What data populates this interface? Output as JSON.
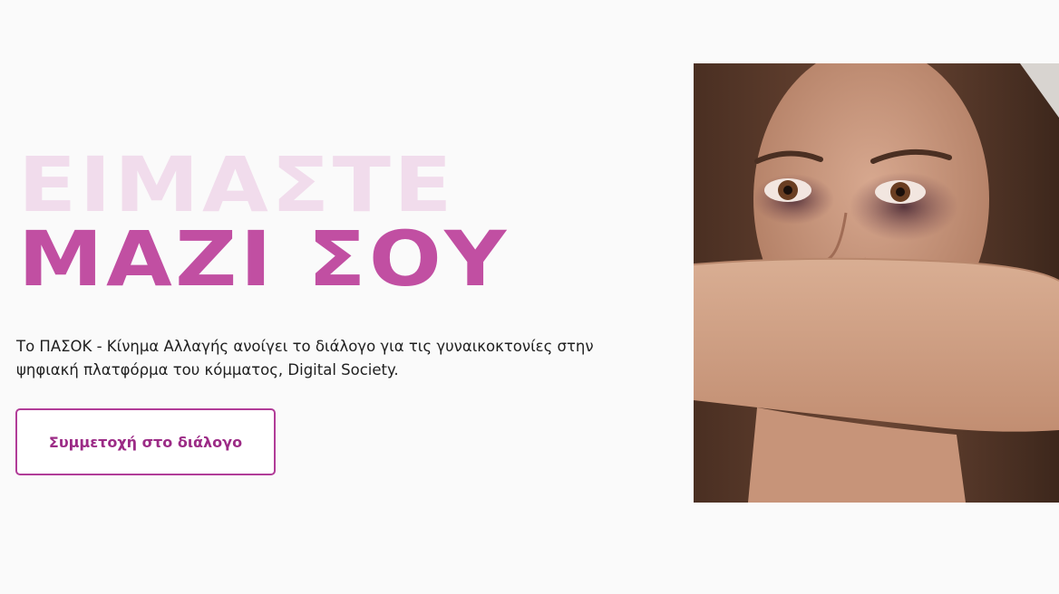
{
  "hero": {
    "headline_line1": "ΕΙΜΑΣΤΕ",
    "headline_line2": "ΜΑΖΙ ΣΟΥ",
    "intro_text": "Το ΠΑΣΟΚ - Κίνημα Αλλαγής ανοίγει το διάλογο για τις γυναικοκτονίες στην ψηφιακή πλατφόρμα του κόμματος, Digital Society.",
    "cta_label": "Συμμετοχή στο διάλογο",
    "image": "photo of woman with bruised eye covering mouth with arm"
  },
  "colors": {
    "background": "#fafafa",
    "headline_light": "#f1dcec",
    "headline_accent": "#c14fa2",
    "button_border": "#b13c98",
    "button_text": "#9c2b86",
    "body_text": "#1f1f1f"
  }
}
